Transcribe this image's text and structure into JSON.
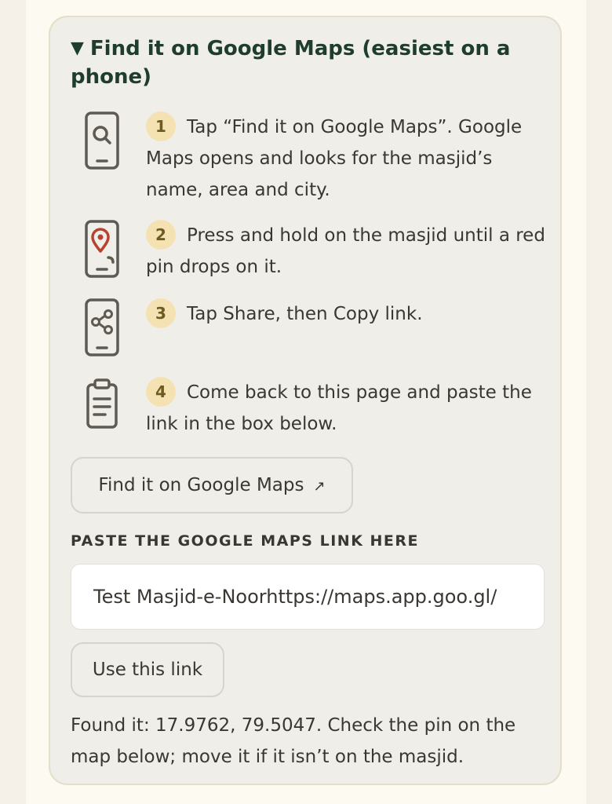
{
  "section": {
    "title": "Find it on Google Maps (easiest on a phone)",
    "toggle_glyph": "▼"
  },
  "steps": [
    {
      "number": "1",
      "icon": "phone-search-icon",
      "text": "Tap “Find it on Google Maps”. Google Maps opens and looks for the masjid’s name, area and city."
    },
    {
      "number": "2",
      "icon": "phone-pin-icon",
      "text": "Press and hold on the masjid until a red pin drops on it."
    },
    {
      "number": "3",
      "icon": "phone-share-icon",
      "text": "Tap Share, then Copy link."
    },
    {
      "number": "4",
      "icon": "clipboard-icon",
      "text": "Come back to this page and paste the link in the box below."
    }
  ],
  "maps_button": {
    "label": "Find it on Google Maps",
    "icon": "external-link-icon",
    "glyph": "↗"
  },
  "link_field": {
    "label": "PASTE THE GOOGLE MAPS LINK HERE",
    "value": "Test Masjid-e-Noorhttps://maps.app.goo.gl/"
  },
  "use_button": {
    "label": "Use this link"
  },
  "result": {
    "text": "Found it: 17.9762, 79.5047. Check the pin on the map below; move it if it isn’t on the masjid."
  },
  "colors": {
    "heading": "#1f3d2b",
    "panel_bg": "#efeee8",
    "number_badge_bg": "#f5e2b3",
    "pin_red": "#b8412f",
    "icon_stroke": "#5f5a52"
  }
}
